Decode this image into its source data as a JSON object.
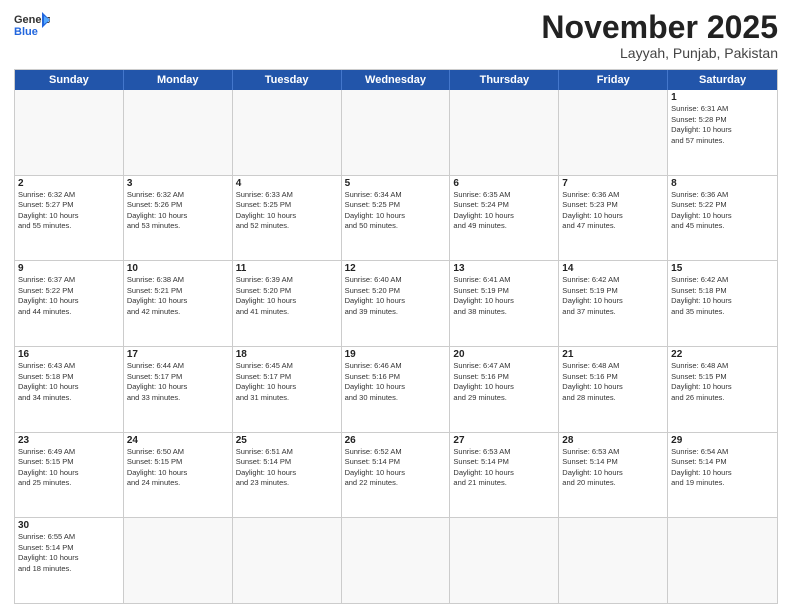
{
  "header": {
    "logo_general": "General",
    "logo_blue": "Blue",
    "month_title": "November 2025",
    "location": "Layyah, Punjab, Pakistan"
  },
  "days_of_week": [
    "Sunday",
    "Monday",
    "Tuesday",
    "Wednesday",
    "Thursday",
    "Friday",
    "Saturday"
  ],
  "weeks": [
    [
      {
        "day": "",
        "info": ""
      },
      {
        "day": "",
        "info": ""
      },
      {
        "day": "",
        "info": ""
      },
      {
        "day": "",
        "info": ""
      },
      {
        "day": "",
        "info": ""
      },
      {
        "day": "",
        "info": ""
      },
      {
        "day": "1",
        "info": "Sunrise: 6:31 AM\nSunset: 5:28 PM\nDaylight: 10 hours\nand 57 minutes."
      }
    ],
    [
      {
        "day": "2",
        "info": "Sunrise: 6:32 AM\nSunset: 5:27 PM\nDaylight: 10 hours\nand 55 minutes."
      },
      {
        "day": "3",
        "info": "Sunrise: 6:32 AM\nSunset: 5:26 PM\nDaylight: 10 hours\nand 53 minutes."
      },
      {
        "day": "4",
        "info": "Sunrise: 6:33 AM\nSunset: 5:25 PM\nDaylight: 10 hours\nand 52 minutes."
      },
      {
        "day": "5",
        "info": "Sunrise: 6:34 AM\nSunset: 5:25 PM\nDaylight: 10 hours\nand 50 minutes."
      },
      {
        "day": "6",
        "info": "Sunrise: 6:35 AM\nSunset: 5:24 PM\nDaylight: 10 hours\nand 49 minutes."
      },
      {
        "day": "7",
        "info": "Sunrise: 6:36 AM\nSunset: 5:23 PM\nDaylight: 10 hours\nand 47 minutes."
      },
      {
        "day": "8",
        "info": "Sunrise: 6:36 AM\nSunset: 5:22 PM\nDaylight: 10 hours\nand 45 minutes."
      }
    ],
    [
      {
        "day": "9",
        "info": "Sunrise: 6:37 AM\nSunset: 5:22 PM\nDaylight: 10 hours\nand 44 minutes."
      },
      {
        "day": "10",
        "info": "Sunrise: 6:38 AM\nSunset: 5:21 PM\nDaylight: 10 hours\nand 42 minutes."
      },
      {
        "day": "11",
        "info": "Sunrise: 6:39 AM\nSunset: 5:20 PM\nDaylight: 10 hours\nand 41 minutes."
      },
      {
        "day": "12",
        "info": "Sunrise: 6:40 AM\nSunset: 5:20 PM\nDaylight: 10 hours\nand 39 minutes."
      },
      {
        "day": "13",
        "info": "Sunrise: 6:41 AM\nSunset: 5:19 PM\nDaylight: 10 hours\nand 38 minutes."
      },
      {
        "day": "14",
        "info": "Sunrise: 6:42 AM\nSunset: 5:19 PM\nDaylight: 10 hours\nand 37 minutes."
      },
      {
        "day": "15",
        "info": "Sunrise: 6:42 AM\nSunset: 5:18 PM\nDaylight: 10 hours\nand 35 minutes."
      }
    ],
    [
      {
        "day": "16",
        "info": "Sunrise: 6:43 AM\nSunset: 5:18 PM\nDaylight: 10 hours\nand 34 minutes."
      },
      {
        "day": "17",
        "info": "Sunrise: 6:44 AM\nSunset: 5:17 PM\nDaylight: 10 hours\nand 33 minutes."
      },
      {
        "day": "18",
        "info": "Sunrise: 6:45 AM\nSunset: 5:17 PM\nDaylight: 10 hours\nand 31 minutes."
      },
      {
        "day": "19",
        "info": "Sunrise: 6:46 AM\nSunset: 5:16 PM\nDaylight: 10 hours\nand 30 minutes."
      },
      {
        "day": "20",
        "info": "Sunrise: 6:47 AM\nSunset: 5:16 PM\nDaylight: 10 hours\nand 29 minutes."
      },
      {
        "day": "21",
        "info": "Sunrise: 6:48 AM\nSunset: 5:16 PM\nDaylight: 10 hours\nand 28 minutes."
      },
      {
        "day": "22",
        "info": "Sunrise: 6:48 AM\nSunset: 5:15 PM\nDaylight: 10 hours\nand 26 minutes."
      }
    ],
    [
      {
        "day": "23",
        "info": "Sunrise: 6:49 AM\nSunset: 5:15 PM\nDaylight: 10 hours\nand 25 minutes."
      },
      {
        "day": "24",
        "info": "Sunrise: 6:50 AM\nSunset: 5:15 PM\nDaylight: 10 hours\nand 24 minutes."
      },
      {
        "day": "25",
        "info": "Sunrise: 6:51 AM\nSunset: 5:14 PM\nDaylight: 10 hours\nand 23 minutes."
      },
      {
        "day": "26",
        "info": "Sunrise: 6:52 AM\nSunset: 5:14 PM\nDaylight: 10 hours\nand 22 minutes."
      },
      {
        "day": "27",
        "info": "Sunrise: 6:53 AM\nSunset: 5:14 PM\nDaylight: 10 hours\nand 21 minutes."
      },
      {
        "day": "28",
        "info": "Sunrise: 6:53 AM\nSunset: 5:14 PM\nDaylight: 10 hours\nand 20 minutes."
      },
      {
        "day": "29",
        "info": "Sunrise: 6:54 AM\nSunset: 5:14 PM\nDaylight: 10 hours\nand 19 minutes."
      }
    ],
    [
      {
        "day": "30",
        "info": "Sunrise: 6:55 AM\nSunset: 5:14 PM\nDaylight: 10 hours\nand 18 minutes."
      },
      {
        "day": "",
        "info": ""
      },
      {
        "day": "",
        "info": ""
      },
      {
        "day": "",
        "info": ""
      },
      {
        "day": "",
        "info": ""
      },
      {
        "day": "",
        "info": ""
      },
      {
        "day": "",
        "info": ""
      }
    ]
  ]
}
